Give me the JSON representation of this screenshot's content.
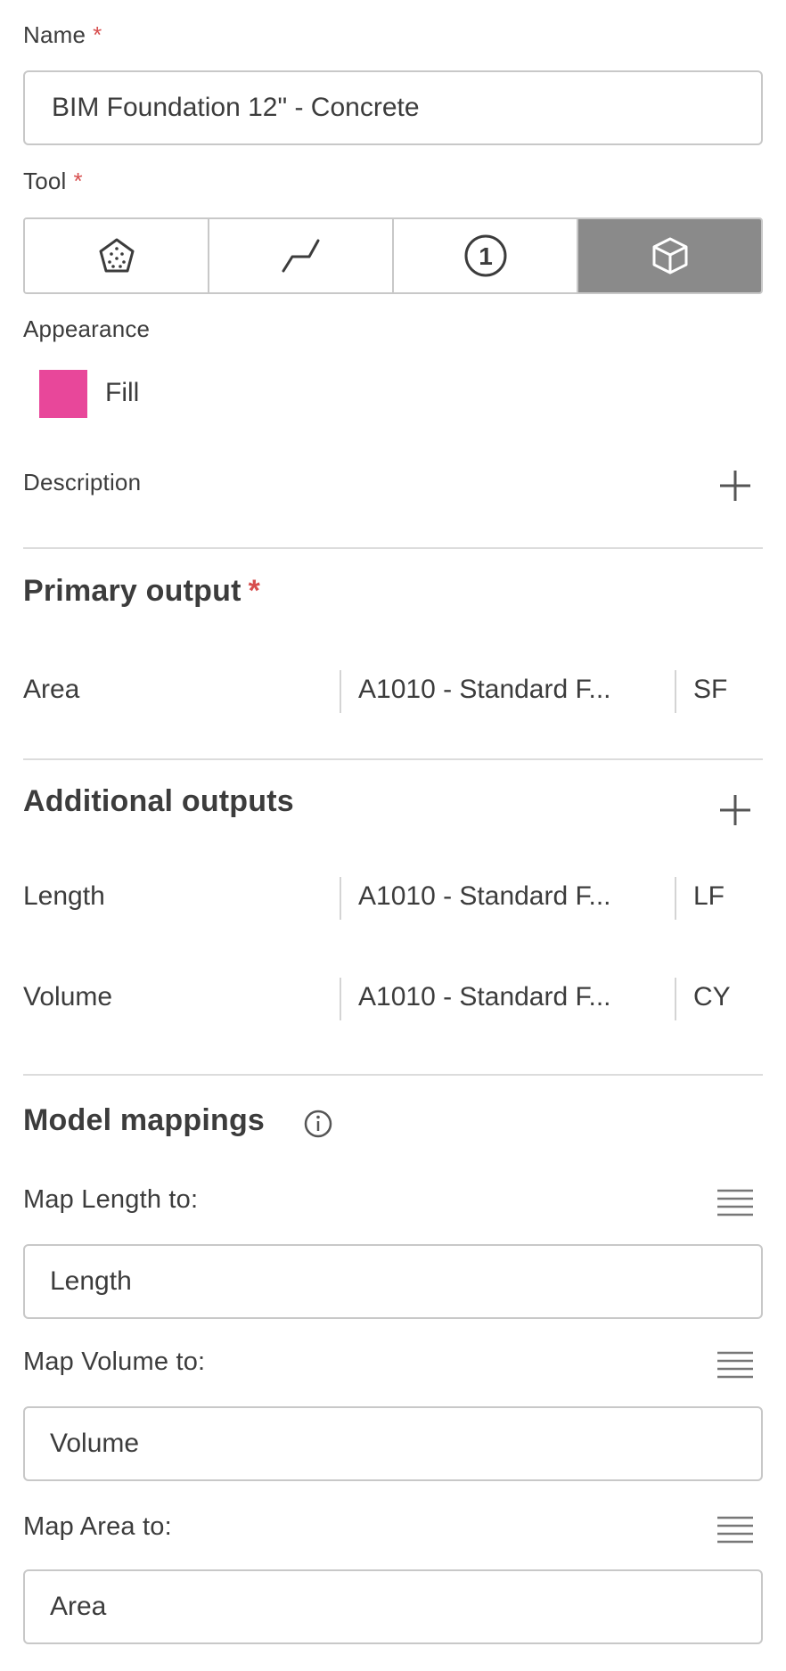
{
  "name": {
    "label": "Name",
    "required": "*",
    "value": "BIM Foundation 12\" - Concrete"
  },
  "tool": {
    "label": "Tool",
    "required": "*",
    "options": [
      {
        "icon": "polygon-area-icon"
      },
      {
        "icon": "linear-line-icon"
      },
      {
        "icon": "count-number-icon",
        "glyph": "1"
      },
      {
        "icon": "cube-3d-icon",
        "selected": true
      }
    ]
  },
  "appearance": {
    "label": "Appearance",
    "swatch_color": "#e8479a",
    "fill_label": "Fill"
  },
  "description": {
    "label": "Description",
    "add_icon": "plus-icon"
  },
  "primary_output": {
    "title": "Primary output",
    "required": "*",
    "rows": [
      {
        "quantity": "Area",
        "classification": "A1010 - Standard F...",
        "unit": "SF"
      }
    ]
  },
  "additional_outputs": {
    "title": "Additional outputs",
    "add_icon": "plus-icon",
    "rows": [
      {
        "quantity": "Length",
        "classification": "A1010 - Standard F...",
        "unit": "LF"
      },
      {
        "quantity": "Volume",
        "classification": "A1010 - Standard F...",
        "unit": "CY"
      }
    ]
  },
  "model_mappings": {
    "title": "Model mappings",
    "info_icon": "info-icon",
    "mappings": [
      {
        "label": "Map Length to:",
        "value": "Length"
      },
      {
        "label": "Map Volume to:",
        "value": "Volume"
      },
      {
        "label": "Map Area to:",
        "value": "Area"
      }
    ]
  },
  "colors": {
    "accent_required": "#d74e4e",
    "selected_tool_bg": "#8a8a8a",
    "border": "#c8c8c8"
  }
}
